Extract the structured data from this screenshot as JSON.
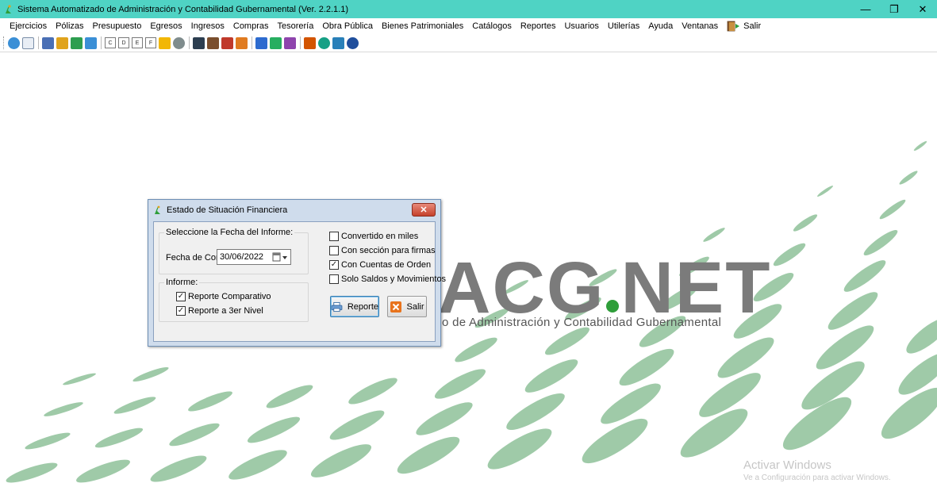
{
  "window": {
    "title": "Sistema Automatizado de Administración y Contabilidad Gubernamental  (Ver. 2.2.1.1)",
    "controls": {
      "minimize": "—",
      "maximize": "❐",
      "close": "✕"
    }
  },
  "menu": {
    "items": [
      "Ejercicios",
      "Pólizas",
      "Presupuesto",
      "Egresos",
      "Ingresos",
      "Compras",
      "Tesorería",
      "Obra Pública",
      "Bienes Patrimoniales",
      "Catálogos",
      "Reportes",
      "Usuarios",
      "Utilerías",
      "Ayuda",
      "Ventanas"
    ],
    "exit_label": "Salir"
  },
  "toolbar": {
    "box_letters": [
      "C",
      "D",
      "E",
      "F"
    ],
    "icon_colors": [
      "#3a8fd6",
      "#2e9e4f",
      "#e0a31c",
      "#4a6fb5",
      "#3a8fd6",
      "#f2b705",
      "#7a4e2d",
      "#c0392b",
      "#2d6bcf",
      "#e07b20",
      "#8e44ad",
      "#27ae60",
      "#d35400",
      "#16a085",
      "#2980b9",
      "#c0392b",
      "#7f8c8d",
      "#2c3e50"
    ]
  },
  "logo": {
    "text_left": "ACG",
    "text_right": "NET",
    "subtitle": "o de Administración y Contabilidad Gubernamental",
    "accent_color": "#2f9e3a"
  },
  "watermark": {
    "line1": "Activar Windows",
    "line2": "Ve a Configuración para activar Windows."
  },
  "dialog": {
    "title": "Estado de Situación Financiera",
    "close_label": "✕",
    "date_group": {
      "legend": "Seleccione la Fecha del Informe:",
      "label": "Fecha de Corte:",
      "value": "30/06/2022"
    },
    "informe_group": {
      "legend": "Informe:",
      "options": [
        {
          "label": "Reporte Comparativo",
          "checked": "✓"
        },
        {
          "label": "Reporte a 3er Nivel",
          "checked": "✓"
        }
      ]
    },
    "options": [
      {
        "label": "Convertido en miles",
        "checked": ""
      },
      {
        "label": "Con sección para firmas",
        "checked": ""
      },
      {
        "label": "Con Cuentas de Orden",
        "checked": "✓"
      },
      {
        "label": "Solo Saldos y Movimientos",
        "checked": ""
      }
    ],
    "report_button": "Reporte",
    "exit_button": "Salir"
  }
}
